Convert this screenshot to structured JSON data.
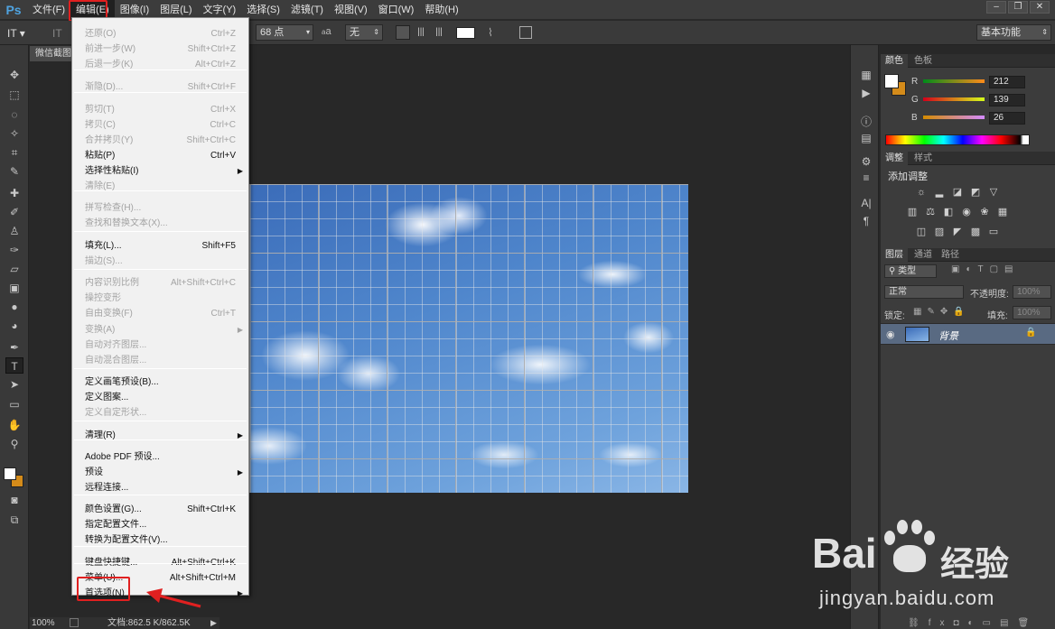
{
  "app": {
    "logo": "Ps"
  },
  "menubar": {
    "items": [
      "文件(F)",
      "编辑(E)",
      "图像(I)",
      "图层(L)",
      "文字(Y)",
      "选择(S)",
      "滤镜(T)",
      "视图(V)",
      "窗口(W)",
      "帮助(H)"
    ],
    "active_index": 1
  },
  "options": {
    "tool_glyph": "IT",
    "font_size": "68 点",
    "aa_icon": "a",
    "aa_mode": "无",
    "workspace": "基本功能"
  },
  "document": {
    "tab_title": "微信截图",
    "zoom": "100%",
    "doc_info": "文档:862.5 K/862.5K"
  },
  "edit_menu": {
    "items": [
      {
        "label": "还原(O)",
        "shortcut": "Ctrl+Z",
        "enabled": false
      },
      {
        "label": "前进一步(W)",
        "shortcut": "Shift+Ctrl+Z",
        "enabled": false
      },
      {
        "label": "后退一步(K)",
        "shortcut": "Alt+Ctrl+Z",
        "enabled": false
      },
      {
        "label": "渐隐(D)...",
        "shortcut": "Shift+Ctrl+F",
        "enabled": false
      },
      {
        "label": "剪切(T)",
        "shortcut": "Ctrl+X",
        "enabled": false
      },
      {
        "label": "拷贝(C)",
        "shortcut": "Ctrl+C",
        "enabled": false
      },
      {
        "label": "合并拷贝(Y)",
        "shortcut": "Shift+Ctrl+C",
        "enabled": false
      },
      {
        "label": "粘贴(P)",
        "shortcut": "Ctrl+V",
        "enabled": true
      },
      {
        "label": "选择性粘贴(I)",
        "shortcut": "",
        "enabled": true,
        "submenu": true
      },
      {
        "label": "清除(E)",
        "shortcut": "",
        "enabled": false
      },
      {
        "label": "拼写检查(H)...",
        "shortcut": "",
        "enabled": false
      },
      {
        "label": "查找和替换文本(X)...",
        "shortcut": "",
        "enabled": false
      },
      {
        "label": "填充(L)...",
        "shortcut": "Shift+F5",
        "enabled": true
      },
      {
        "label": "描边(S)...",
        "shortcut": "",
        "enabled": false
      },
      {
        "label": "内容识别比例",
        "shortcut": "Alt+Shift+Ctrl+C",
        "enabled": false
      },
      {
        "label": "操控变形",
        "shortcut": "",
        "enabled": false
      },
      {
        "label": "自由变换(F)",
        "shortcut": "Ctrl+T",
        "enabled": false
      },
      {
        "label": "变换(A)",
        "shortcut": "",
        "enabled": false,
        "submenu": true
      },
      {
        "label": "自动对齐图层...",
        "shortcut": "",
        "enabled": false
      },
      {
        "label": "自动混合图层...",
        "shortcut": "",
        "enabled": false
      },
      {
        "label": "定义画笔预设(B)...",
        "shortcut": "",
        "enabled": true
      },
      {
        "label": "定义图案...",
        "shortcut": "",
        "enabled": true
      },
      {
        "label": "定义自定形状...",
        "shortcut": "",
        "enabled": false
      },
      {
        "label": "清理(R)",
        "shortcut": "",
        "enabled": true,
        "submenu": true
      },
      {
        "label": "Adobe PDF 预设...",
        "shortcut": "",
        "enabled": true
      },
      {
        "label": "预设",
        "shortcut": "",
        "enabled": true,
        "submenu": true
      },
      {
        "label": "远程连接...",
        "shortcut": "",
        "enabled": true
      },
      {
        "label": "颜色设置(G)...",
        "shortcut": "Shift+Ctrl+K",
        "enabled": true
      },
      {
        "label": "指定配置文件...",
        "shortcut": "",
        "enabled": true
      },
      {
        "label": "转换为配置文件(V)...",
        "shortcut": "",
        "enabled": true
      },
      {
        "label": "键盘快捷键...",
        "shortcut": "Alt+Shift+Ctrl+K",
        "enabled": true
      },
      {
        "label": "菜单(U)...",
        "shortcut": "Alt+Shift+Ctrl+M",
        "enabled": true
      },
      {
        "label": "首选项(N)",
        "shortcut": "",
        "enabled": true,
        "submenu": true
      }
    ]
  },
  "color_panel": {
    "tabs": [
      "颜色",
      "色板"
    ],
    "channels": [
      {
        "name": "R",
        "value": "212"
      },
      {
        "name": "G",
        "value": "139"
      },
      {
        "name": "B",
        "value": "26"
      }
    ],
    "foreground": "#ffffff",
    "background": "#d48b1a"
  },
  "adjust_panel": {
    "tabs": [
      "调整",
      "样式"
    ],
    "heading": "添加调整"
  },
  "layers_panel": {
    "tabs": [
      "图层",
      "通道",
      "路径"
    ],
    "filter": "类型",
    "blend_mode": "正常",
    "opacity_label": "不透明度:",
    "opacity": "100%",
    "lock_label": "锁定:",
    "fill_label": "填充:",
    "fill": "100%",
    "layers": [
      {
        "name": "背景",
        "visible": true,
        "locked": true
      }
    ]
  },
  "watermark": {
    "brand": "Bai",
    "brand_right": "经验",
    "url": "jingyan.baidu.com"
  },
  "colors": {
    "highlight_box": "#e02020",
    "arrow": "#e02020"
  }
}
